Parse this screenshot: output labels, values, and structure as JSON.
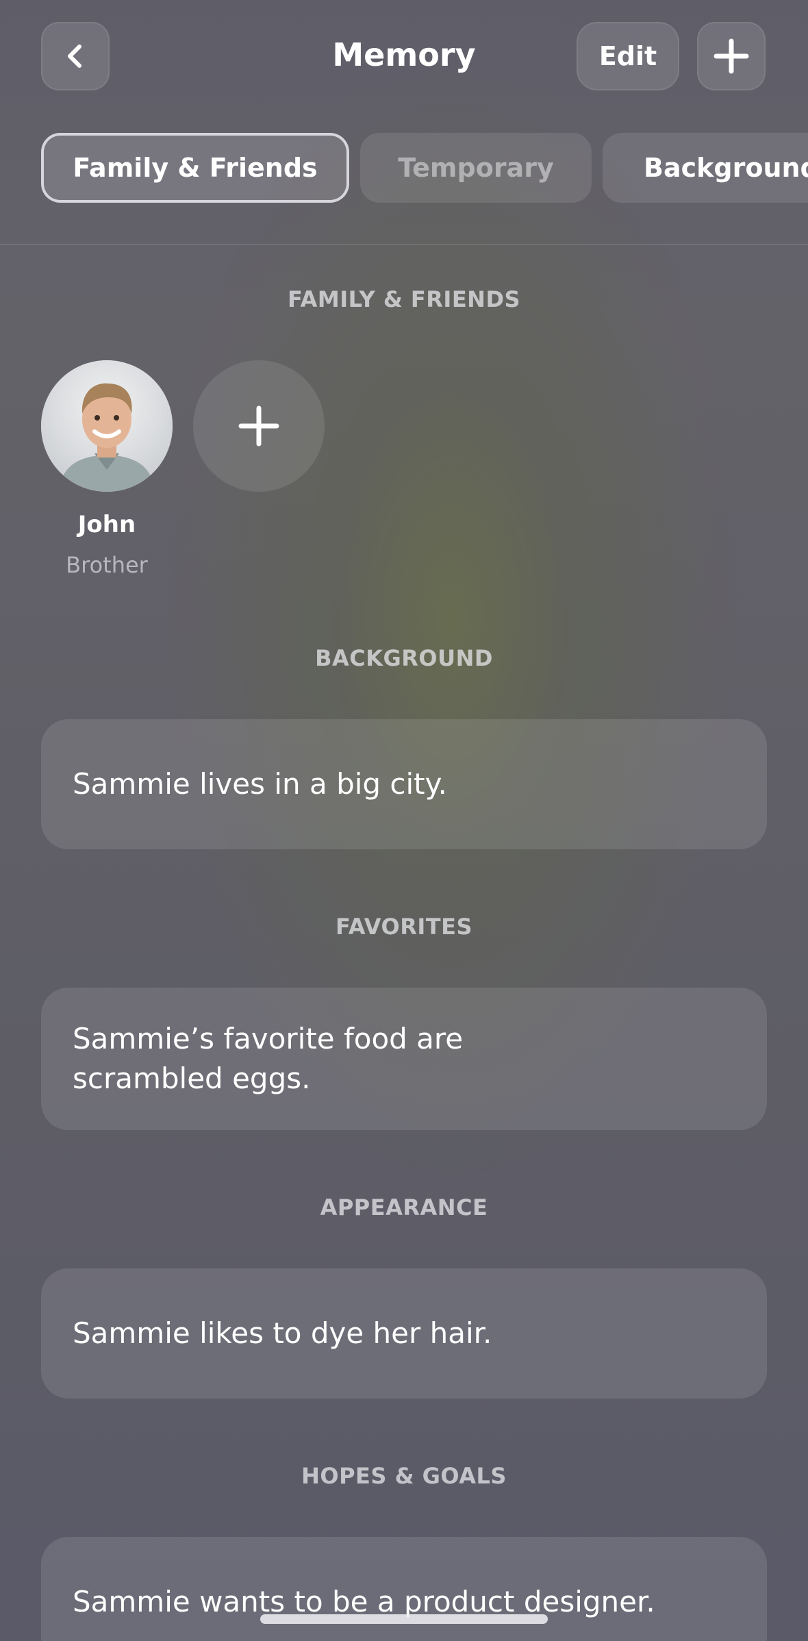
{
  "header": {
    "title": "Memory",
    "edit_label": "Edit",
    "back_icon": "chevron-left-icon",
    "add_icon": "plus-icon"
  },
  "tabs": [
    {
      "label": "Family & Friends",
      "active": true
    },
    {
      "label": "Temporary",
      "active": false
    },
    {
      "label": "Background",
      "active": false
    }
  ],
  "sections": {
    "family": {
      "heading": "FAMILY & FRIENDS",
      "people": [
        {
          "name": "John",
          "relation": "Brother"
        }
      ],
      "add_icon": "plus-icon"
    },
    "background": {
      "heading": "BACKGROUND",
      "items": [
        "Sammie lives in a big city."
      ]
    },
    "favorites": {
      "heading": "FAVORITES",
      "items": [
        "Sammie’s favorite food are scrambled eggs."
      ]
    },
    "appearance": {
      "heading": "APPEARANCE",
      "items": [
        "Sammie likes to dye her hair."
      ]
    },
    "hopes_goals": {
      "heading": "HOPES & GOALS",
      "items": [
        "Sammie wants to be a product designer."
      ]
    }
  },
  "colors": {
    "background": "#5f5e66",
    "card": "#707078",
    "text": "#ffffff",
    "muted": "#c8c8cf"
  }
}
